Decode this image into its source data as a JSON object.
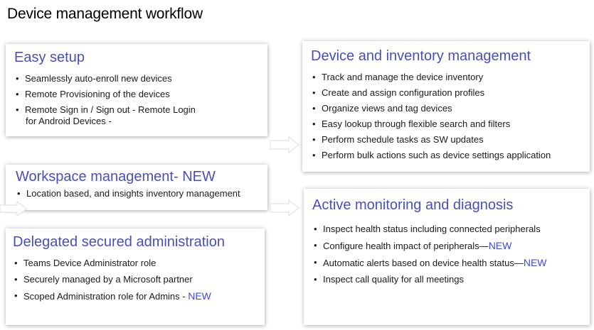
{
  "page": {
    "title": "Device management workflow"
  },
  "accent_color": "#4a4fb8",
  "new_color": "#3b4bd6",
  "cards": {
    "easy_setup": {
      "title": "Easy setup",
      "items": [
        "Seamlessly auto-enroll new devices",
        "Remote Provisioning of the devices",
        "Remote Sign in / Sign out - Remote Login",
        "for Android Devices -"
      ]
    },
    "workspace": {
      "title": "Workspace management-",
      "tag": "NEW",
      "items": [
        "Location based, and insights inventory management"
      ]
    },
    "delegated": {
      "title": "Delegated secured administration",
      "items": [
        "Teams Device Administrator role",
        "Securely managed by a Microsoft partner",
        "Scoped Administration role for Admins -"
      ],
      "item3_tag": "NEW"
    },
    "inventory": {
      "title": "Device and inventory management",
      "items": [
        "Track and manage the device inventory",
        "Create and assign configuration profiles",
        "Organize views and tag devices",
        "Easy lookup through flexible search and filters",
        "Perform schedule tasks as SW updates",
        "Perform bulk actions such as device settings application"
      ]
    },
    "monitoring": {
      "title": "Active monitoring and diagnosis",
      "items": [
        "Inspect health status including connected peripherals",
        "Configure health impact of peripherals—",
        "Automatic alerts based on device health status—",
        "Inspect call quality for all meetings"
      ],
      "item2_tag": "NEW",
      "item3_tag": "NEW"
    }
  }
}
